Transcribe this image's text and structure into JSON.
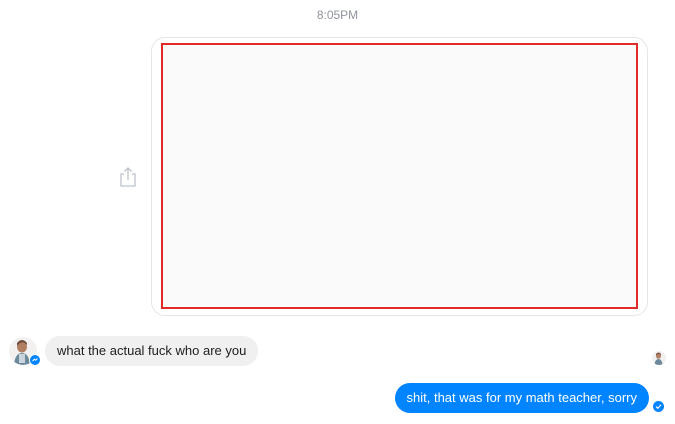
{
  "conversation": {
    "timestamp": "8:05PM",
    "messages": [
      {
        "direction": "outgoing",
        "type": "image",
        "icon": "share-icon"
      },
      {
        "direction": "incoming",
        "text": "what the actual fuck who are you"
      },
      {
        "direction": "outgoing",
        "text": "shit, that was for my math teacher, sorry",
        "status": "delivered"
      }
    ]
  },
  "colors": {
    "accent": "#0084ff",
    "incoming_bubble": "#f1f0f0",
    "image_border": "#e02b2b",
    "timestamp_text": "#90949c"
  }
}
